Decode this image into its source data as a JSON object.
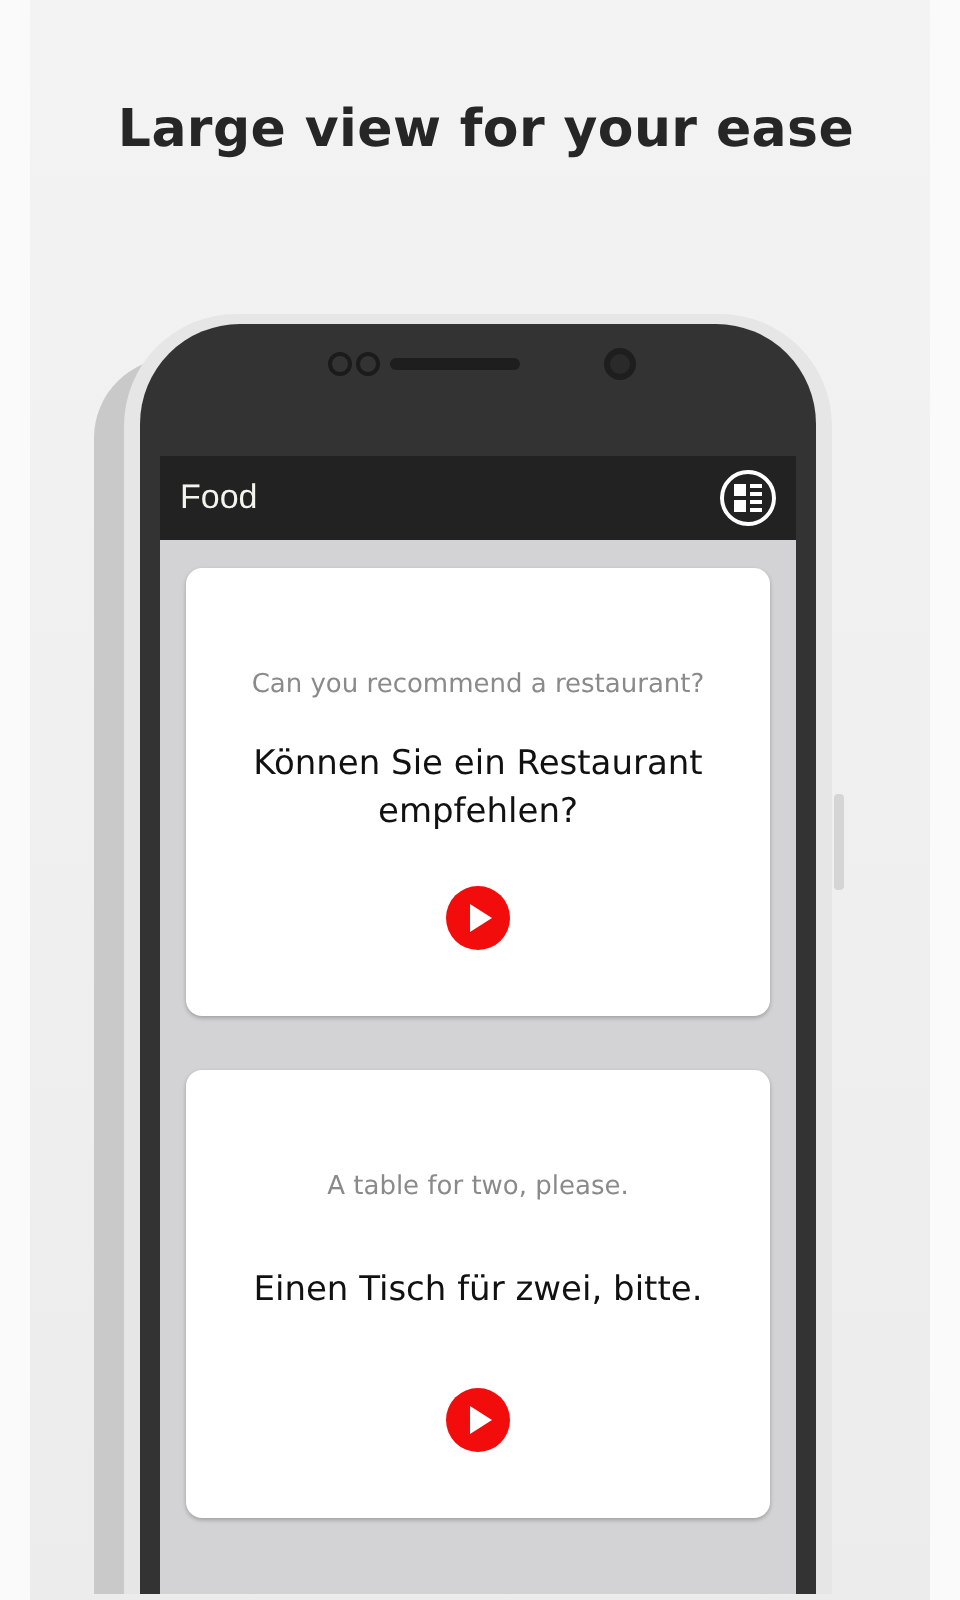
{
  "headline": "Large view for your ease",
  "app_bar": {
    "title": "Food"
  },
  "cards": [
    {
      "english": "Can you recommend a restaurant?",
      "translation": "Können Sie ein Restaurant empfehlen?"
    },
    {
      "english": "A table for two, please.",
      "translation": "Einen Tisch für zwei, bitte."
    }
  ]
}
